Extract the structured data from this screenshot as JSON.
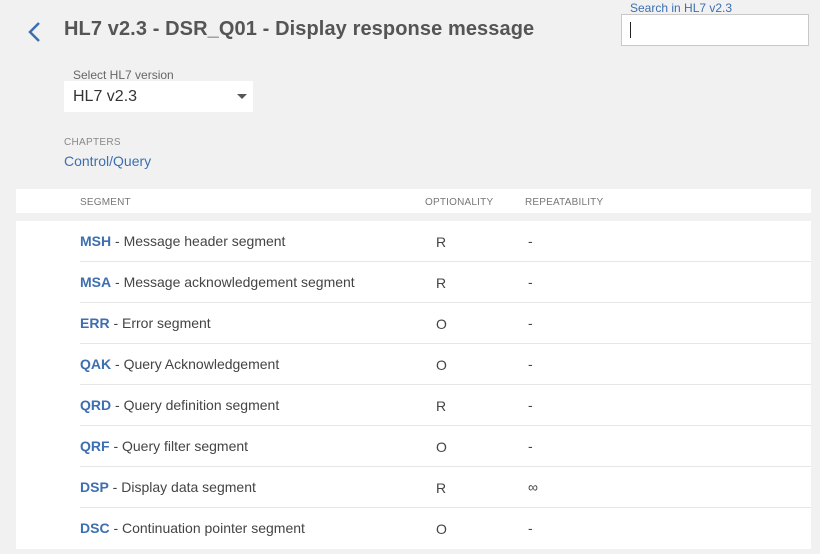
{
  "header": {
    "title": "HL7 v2.3 - DSR_Q01 - Display response message",
    "back_icon": "chevron-left-icon"
  },
  "search": {
    "label": "Search in HL7 v2.3",
    "value": ""
  },
  "version_select": {
    "label": "Select HL7 version",
    "value": "HL7 v2.3"
  },
  "chapters": {
    "label": "CHAPTERS",
    "link": "Control/Query"
  },
  "table": {
    "columns": {
      "segment": "SEGMENT",
      "optionality": "OPTIONALITY",
      "repeatability": "REPEATABILITY"
    },
    "rows": [
      {
        "code": "MSH",
        "desc": " - Message header segment",
        "opt": "R",
        "rep": "-"
      },
      {
        "code": "MSA",
        "desc": " - Message acknowledgement segment",
        "opt": "R",
        "rep": "-"
      },
      {
        "code": "ERR",
        "desc": " - Error segment",
        "opt": "O",
        "rep": "-"
      },
      {
        "code": "QAK",
        "desc": " - Query Acknowledgement",
        "opt": "O",
        "rep": "-"
      },
      {
        "code": "QRD",
        "desc": " - Query definition segment",
        "opt": "R",
        "rep": "-"
      },
      {
        "code": "QRF",
        "desc": " - Query filter segment",
        "opt": "O",
        "rep": "-"
      },
      {
        "code": "DSP",
        "desc": " - Display data segment",
        "opt": "R",
        "rep": "∞"
      },
      {
        "code": "DSC",
        "desc": " - Continuation pointer segment",
        "opt": "O",
        "rep": "-"
      }
    ]
  },
  "colors": {
    "accent": "#3d6fb0",
    "background": "#f1f1f1"
  }
}
